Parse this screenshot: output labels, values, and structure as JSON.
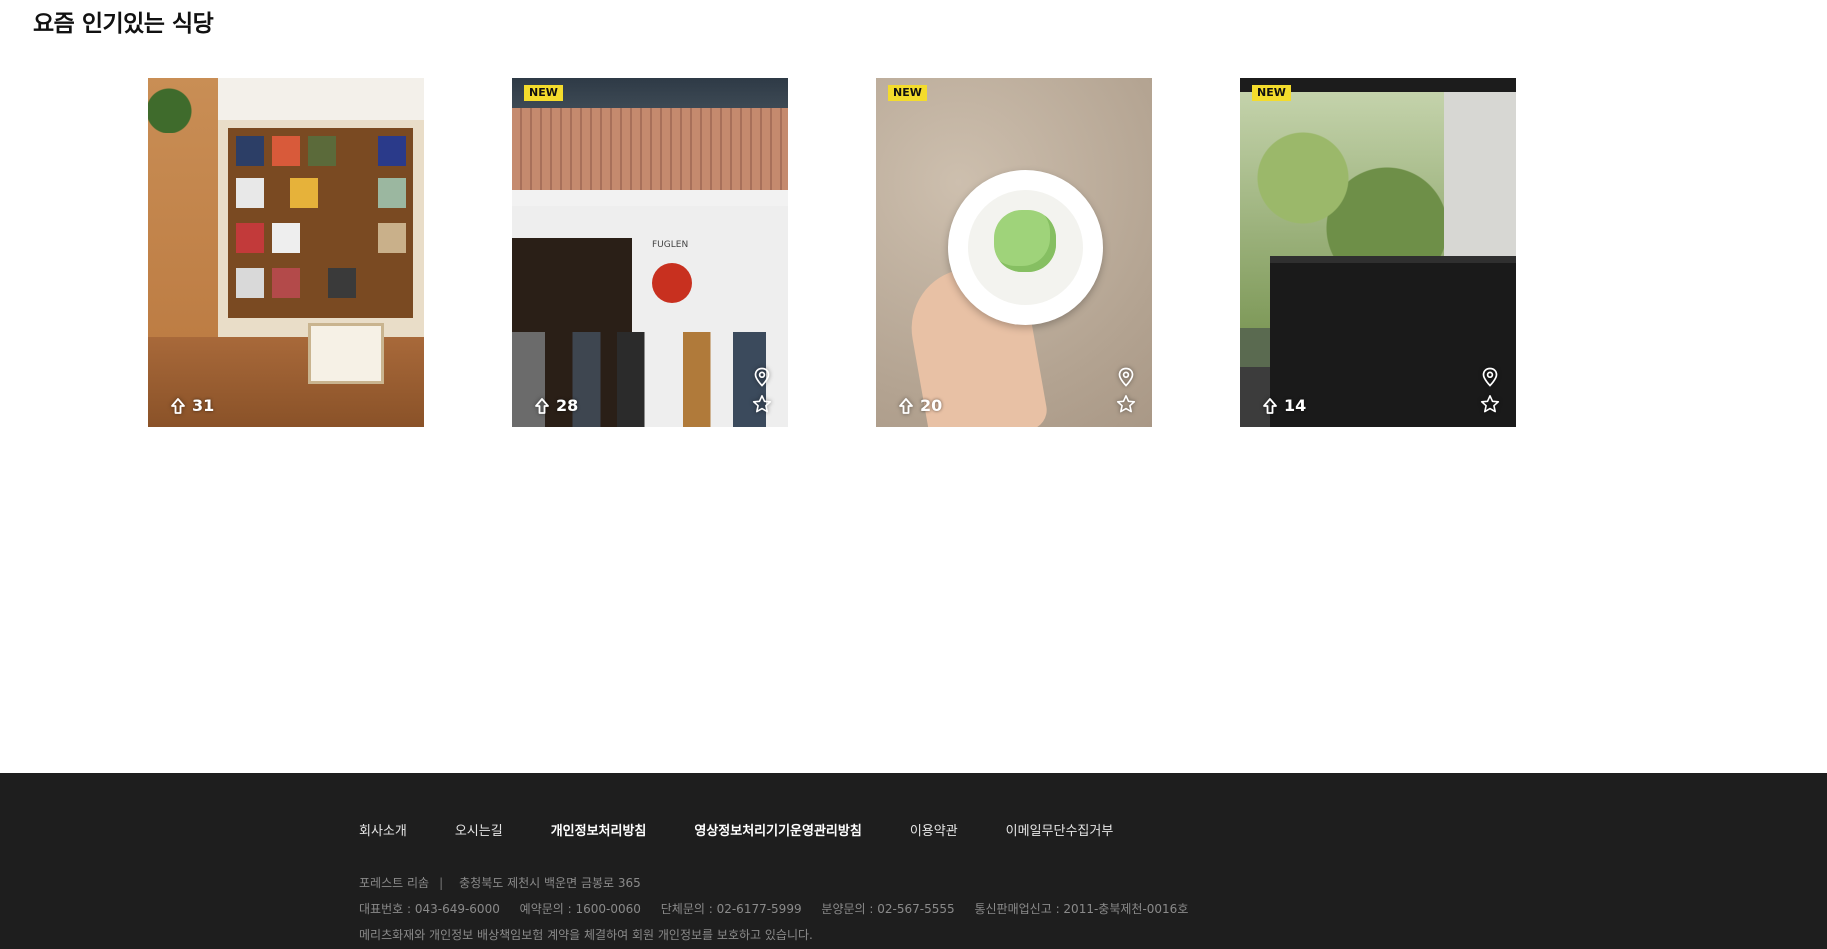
{
  "section": {
    "title": "요즘 인기있는 식당"
  },
  "colors": {
    "badge": "#f4dc2c",
    "footer_bg": "#1e1e1e"
  },
  "cards": [
    {
      "badge": "",
      "up_count": "31",
      "icons": [
        "arrow-up-icon"
      ]
    },
    {
      "badge": "NEW",
      "up_count": "28",
      "icons": [
        "arrow-up-icon",
        "map-pin-icon",
        "star-icon"
      ]
    },
    {
      "badge": "NEW",
      "up_count": "20",
      "icons": [
        "arrow-up-icon",
        "map-pin-icon",
        "star-icon"
      ]
    },
    {
      "badge": "NEW",
      "up_count": "14",
      "icons": [
        "arrow-up-icon",
        "map-pin-icon",
        "star-icon"
      ]
    }
  ],
  "card2_sign": "FUGLEN",
  "footer": {
    "nav": [
      "회사소개",
      "오시는길",
      "개인정보처리방침",
      "영상정보처리기기운영관리방침",
      "이용약관",
      "이메일무단수집거부"
    ],
    "company": "포레스트 리솜",
    "address": "충청북도 제천시 백운면 금봉로 365",
    "contacts": [
      "대표번호 : 043-649-6000",
      "예약문의 : 1600-0060",
      "단체문의 : 02-6177-5999",
      "분양문의 : 02-567-5555",
      "통신판매업신고 : 2011-충북제천-0016호"
    ],
    "insurance": "메리츠화재와 개인정보 배상책임보험 계약을 체결하여 회원 개인정보를 보호하고 있습니다."
  }
}
